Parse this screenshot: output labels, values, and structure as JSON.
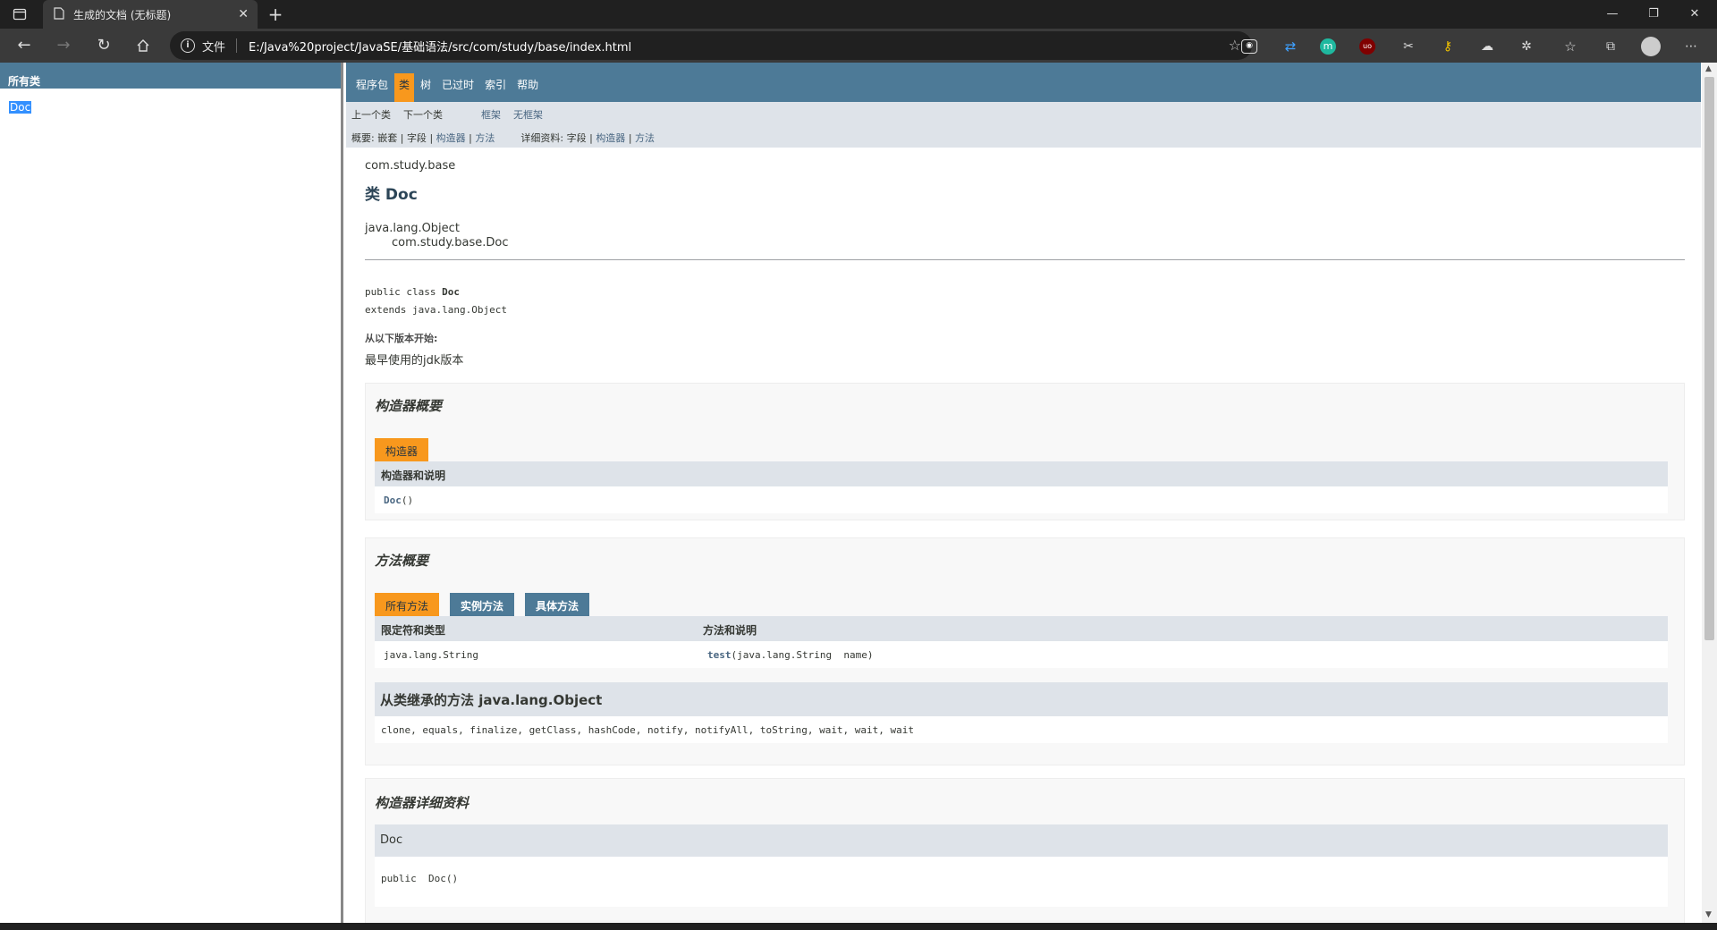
{
  "browser": {
    "tab_title": "生成的文档 (无标题)",
    "address_label": "文件",
    "url": "E:/Java%20project/JavaSE/基础语法/src/com/study/base/index.html",
    "window_controls": [
      "—",
      "❐",
      "✕"
    ],
    "toolbar_icon_labels": [
      "m",
      "uo"
    ]
  },
  "left_frame": {
    "header": "所有类",
    "class_link": "Doc"
  },
  "nav": {
    "top_items": [
      "程序包",
      "类",
      "树",
      "已过时",
      "索引",
      "帮助"
    ],
    "active_item": "类",
    "prev_class": "上一个类",
    "next_class": "下一个类",
    "frames": "框架",
    "no_frames": "无框架",
    "summary_label": "概要:",
    "summary_nested": "嵌套",
    "summary_field": "字段",
    "summary_constructor": "构造器",
    "summary_method": "方法",
    "detail_label": "详细资料:",
    "detail_field": "字段",
    "detail_constructor": "构造器",
    "detail_method": "方法",
    "separator": "|"
  },
  "class_info": {
    "package": "com.study.base",
    "title": "类 Doc",
    "inherit_parent": "java.lang.Object",
    "inherit_child": "com.study.base.Doc",
    "sig_prefix": "public class ",
    "sig_name": "Doc",
    "sig_extends": "extends java.lang.Object",
    "since_label": "从以下版本开始:",
    "since_value": "最早使用的jdk版本"
  },
  "constructor_summary": {
    "heading": "构造器概要",
    "tab": "构造器",
    "column": "构造器和说明",
    "name": "Doc",
    "params": "()"
  },
  "method_summary": {
    "heading": "方法概要",
    "tabs": [
      "所有方法",
      "实例方法",
      "具体方法"
    ],
    "columns": [
      "限定符和类型",
      "方法和说明"
    ],
    "row_type": "java.lang.String",
    "row_method": "test",
    "row_params": "(java.lang.String  name)",
    "inherited_heading": "从类继承的方法 java.lang.Object",
    "inherited_methods": "clone, equals, finalize, getClass, hashCode, notify, notifyAll, toString, wait, wait, wait"
  },
  "constructor_detail": {
    "heading": "构造器详细资料",
    "name": "Doc",
    "signature": "public  Doc()"
  },
  "colors": {
    "nav_bg": "#4d7a97",
    "active_tab": "#f8981d",
    "subnav_bg": "#dee3e9",
    "link": "#4a6782"
  }
}
